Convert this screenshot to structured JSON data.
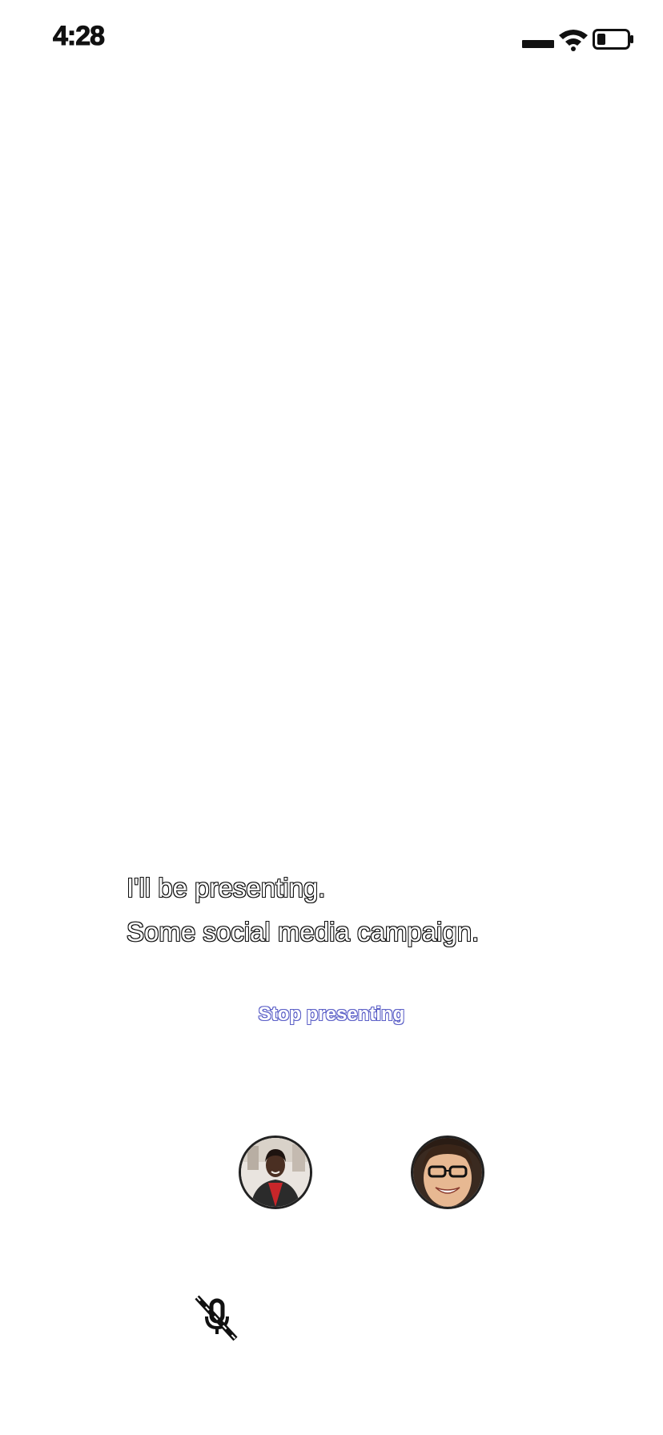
{
  "status_bar": {
    "time": "4:28",
    "icons": [
      "cellular-signal-icon",
      "wifi-icon",
      "battery-icon"
    ]
  },
  "presentation": {
    "line1": "I'll be presenting.",
    "line2": "Some social media campaign.",
    "stop_label": "Stop presenting"
  },
  "participants": [
    {
      "avatar": "participant-1-avatar"
    },
    {
      "avatar": "participant-2-avatar"
    }
  ],
  "controls": {
    "mic": "mic-off-icon"
  },
  "colors": {
    "accent": "#5b5fc7",
    "text": "#111111",
    "background": "#ffffff"
  }
}
